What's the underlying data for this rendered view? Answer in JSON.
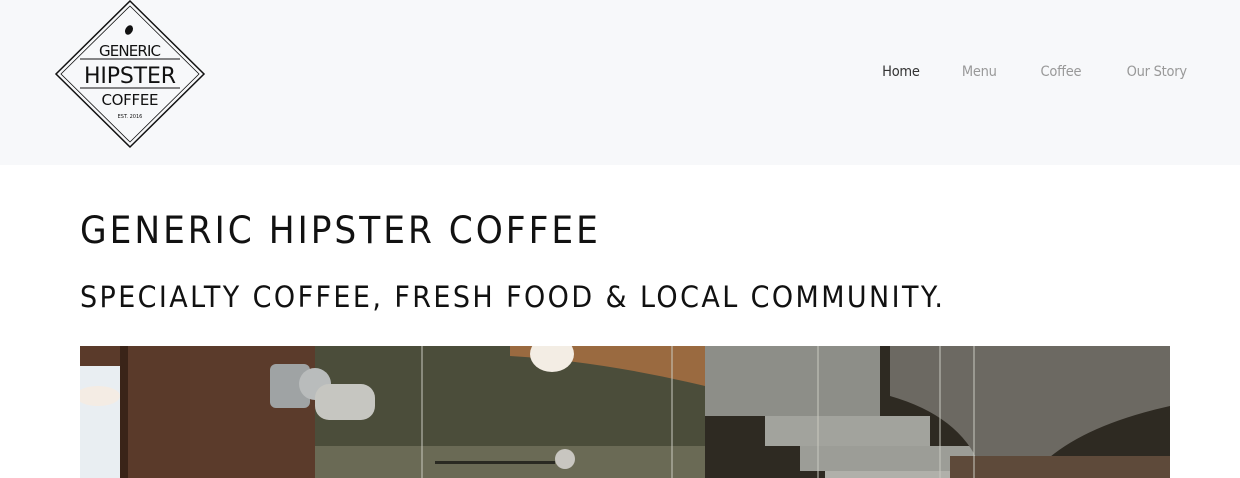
{
  "header": {
    "logo": {
      "line1": "GENERIC",
      "line2": "HIPSTER",
      "line3": "COFFEE",
      "est": "EST. 2016"
    },
    "nav": [
      {
        "label": "Home",
        "active": true
      },
      {
        "label": "Menu",
        "active": false
      },
      {
        "label": "Coffee",
        "active": false
      },
      {
        "label": "Our Story",
        "active": false
      }
    ]
  },
  "main": {
    "title": "GENERIC HIPSTER COFFEE",
    "subtitle": "SPECIALTY COFFEE, FRESH FOOD & LOCAL COMMUNITY."
  },
  "colors": {
    "header_bg": "#f7f8fa",
    "nav_active": "#333333",
    "nav_inactive": "#999999"
  }
}
